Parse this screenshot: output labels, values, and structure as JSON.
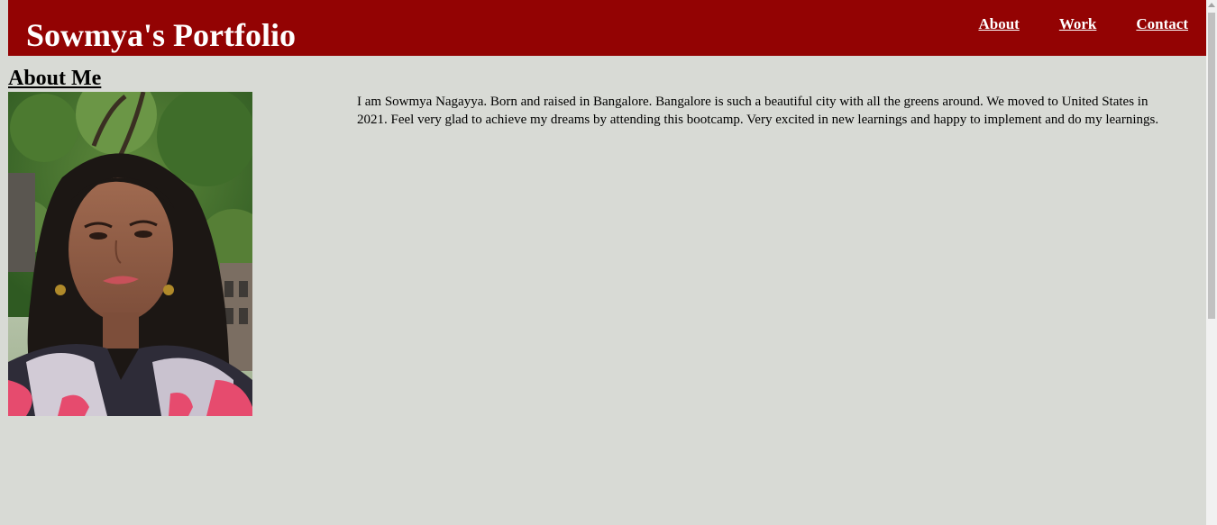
{
  "header": {
    "title": "Sowmya's Portfolio",
    "nav": [
      {
        "label": "About"
      },
      {
        "label": "Work"
      },
      {
        "label": "Contact"
      }
    ]
  },
  "about": {
    "heading": "About Me",
    "photo_alt": "Portrait photo of Sowmya",
    "text": "I am Sowmya Nagayya. Born and raised in Bangalore. Bangalore is such a beautiful city with all the greens around. We moved to United States in 2021. Feel very glad to achieve my dreams by attending this bootcamp. Very excited in new learnings and happy to implement and do my learnings."
  },
  "colors": {
    "header_bg": "#930303",
    "page_bg": "#d8dad5",
    "header_text": "#ffffff"
  },
  "icons": {
    "scroll_up": "arrow-up-icon"
  }
}
